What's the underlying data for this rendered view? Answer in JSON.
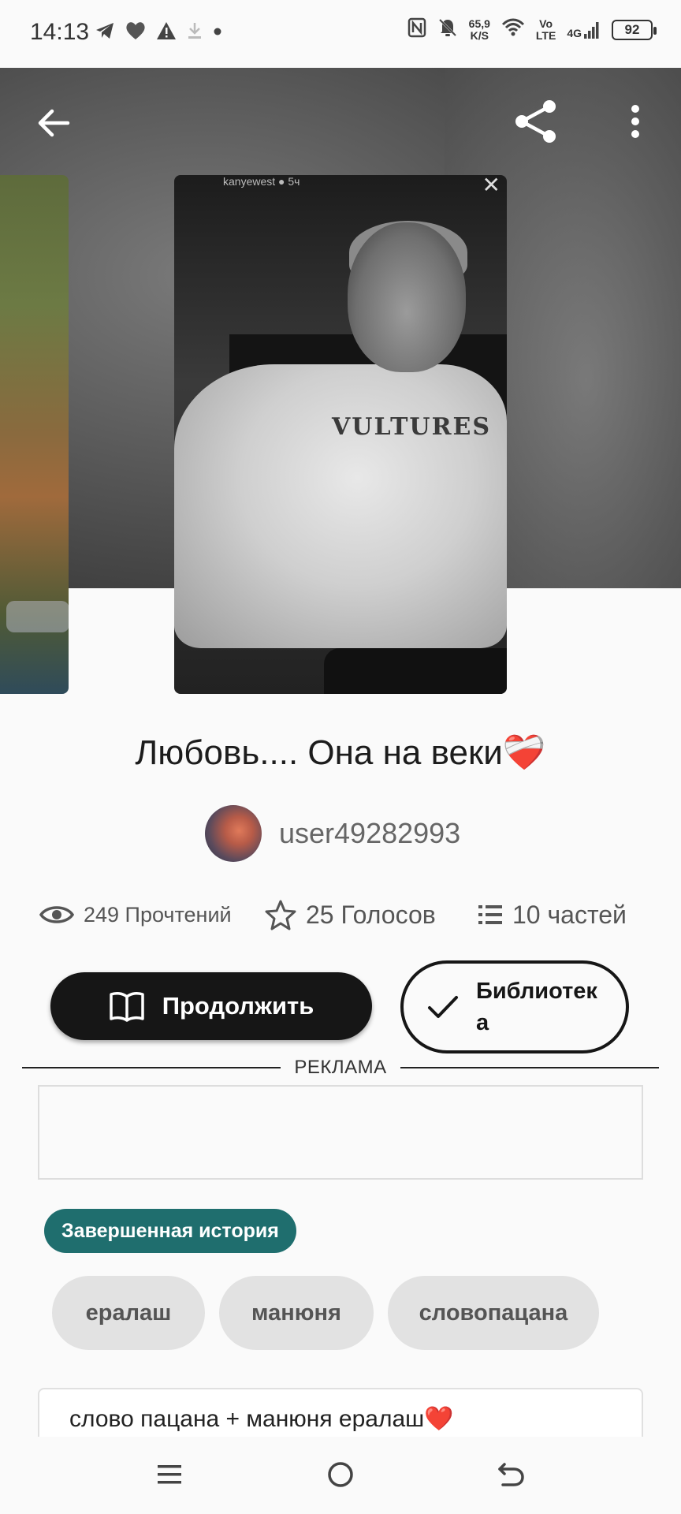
{
  "status_bar": {
    "time": "14:13",
    "net_speed_value": "65,9",
    "net_speed_unit": "K/S",
    "volte_top": "Vo",
    "volte_bottom": "LTE",
    "network": "4G",
    "battery": "92"
  },
  "header": {
    "back_icon": "arrow-left-icon",
    "share_icon": "share-icon",
    "more_icon": "more-vertical-icon"
  },
  "cover": {
    "caption": "kanyewest ● 5ч",
    "shirt_text": "VULTURES"
  },
  "story": {
    "title": "Любовь.... Она на веки❤️‍🩹",
    "author": "user49282993",
    "reads": "249 Прочтений",
    "votes": "25 Голосов",
    "parts": "10 частей"
  },
  "actions": {
    "continue_label": "Продолжить",
    "library_label": "Библиотека"
  },
  "ad": {
    "label": "РЕКЛАМА"
  },
  "status_badge": "Завершенная история",
  "tags": [
    "ералаш",
    "манюня",
    "словопацана"
  ],
  "description": "слово пацана + манюня ералаш❤️",
  "colors": {
    "accent_badge": "#1f6e6e",
    "primary_button": "#161616",
    "tag_background": "#e2e2e2"
  }
}
